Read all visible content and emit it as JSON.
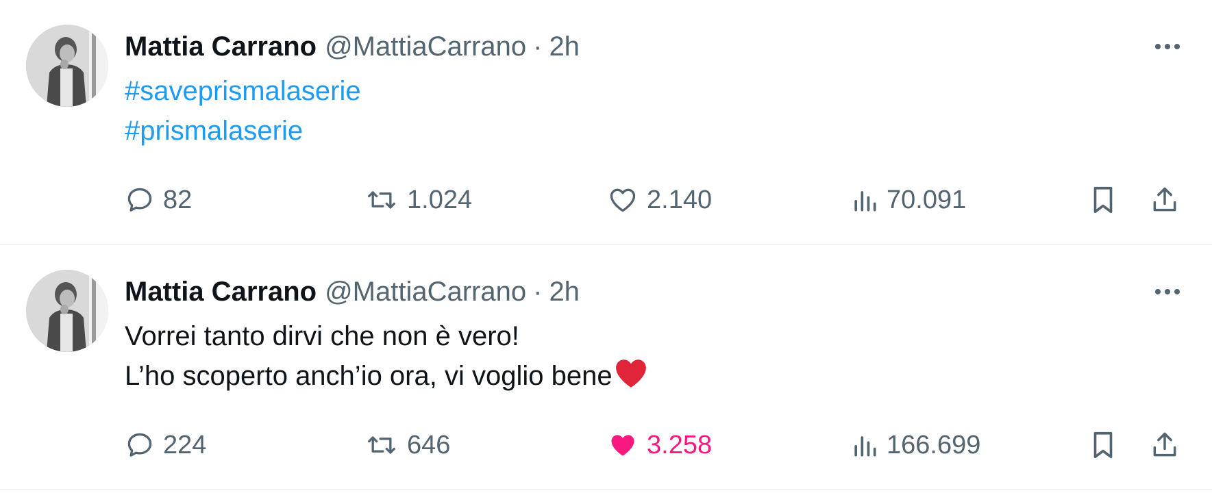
{
  "tweets": [
    {
      "author": {
        "name": "Mattia Carrano",
        "handle": "@MattiaCarrano",
        "separator": "·",
        "time": "2h"
      },
      "content": {
        "hashtags": [
          "#saveprismalaserie",
          "#prismalaserie"
        ],
        "lines": []
      },
      "stats": {
        "replies": "82",
        "retweets": "1.024",
        "likes": "2.140",
        "views": "70.091"
      },
      "liked": false
    },
    {
      "author": {
        "name": "Mattia Carrano",
        "handle": "@MattiaCarrano",
        "separator": "·",
        "time": "2h"
      },
      "content": {
        "hashtags": [],
        "lines": [
          "Vorrei tanto dirvi che non è vero!",
          "L’ho scoperto anch’io ora, vi voglio bene"
        ]
      },
      "stats": {
        "replies": "224",
        "retweets": "646",
        "likes": "3.258",
        "views": "166.699"
      },
      "liked": true
    }
  ],
  "icons": {
    "reply": "reply-icon",
    "retweet": "retweet-icon",
    "like": "heart-icon",
    "views": "views-icon",
    "bookmark": "bookmark-icon",
    "share": "share-icon",
    "more": "more-icon"
  },
  "colors": {
    "text": "#0f1419",
    "secondary": "#536471",
    "link": "#1d9bf0",
    "like_active": "#f91880",
    "divider": "#eff3f4"
  }
}
